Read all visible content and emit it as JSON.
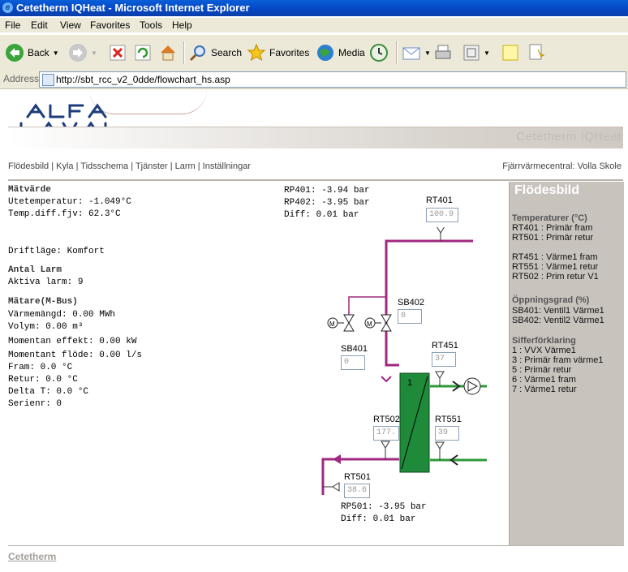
{
  "window": {
    "title": "Cetetherm IQHeat - Microsoft Internet Explorer"
  },
  "menu": [
    "File",
    "Edit",
    "View",
    "Favorites",
    "Tools",
    "Help"
  ],
  "toolbar": {
    "back": "Back",
    "search": "Search",
    "favorites": "Favorites",
    "media": "Media"
  },
  "address": {
    "label": "Address",
    "url": "http://sbt_rcc_v2_0dde/flowchart_hs.asp"
  },
  "brand": "Cetetherm IQHeat",
  "nav": "Flödesbild |  Kyla | Tidsschema | Tjänster | Larm | Inställningar",
  "facility": "Fjärrvärmecentral: Volla Skole",
  "left": {
    "matvarde_title": "Mätvärde",
    "ute": "Utetemperatur: -1.049°C",
    "tempdiff": "Temp.diff.fjv: 62.3°C",
    "drift": "Driftläge: Komfort",
    "antal_larm_title": "Antal Larm",
    "aktiva_larm": "Aktiva larm: 9",
    "matare_title": "Mätare(M-Bus)",
    "varmemangd": "Värmemängd: 0.00 MWh",
    "volym": "Volym: 0.00 m³",
    "effekt": "Momentan effekt: 0.00 kW",
    "flode": "Momentant flöde: 0.00 l/s",
    "fram": "Fram: 0.0 °C",
    "retur": "Retur: 0.0 °C",
    "deltat": "Delta T: 0.0 °C",
    "serienr": "Serienr: 0"
  },
  "diagram": {
    "rp401": "RP401: -3.94 bar",
    "rp402": "RP402: -3.95 bar",
    "diff1": "Diff: 0.01 bar",
    "rp501": "RP501: -3.95 bar",
    "diff2": "Diff: 0.01 bar",
    "rt401_label": "RT401",
    "rt401_value": "100.9",
    "sb402_label": "SB402",
    "sb402_value": "0",
    "sb401_label": "SB401",
    "sb401_value": "0",
    "rt451_label": "RT451",
    "rt451_value": "37",
    "rt502_label": "RT502",
    "rt502_value": "177.",
    "rt551_label": "RT551",
    "rt551_value": "39",
    "rt501_label": "RT501",
    "rt501_value": "38.6",
    "hx_number": "1",
    "motor_symbol": "M",
    "colors": {
      "primary": "#a0287f",
      "secondary": "#2e9a3a",
      "hx": "#1e8a3a"
    }
  },
  "panel": {
    "title": "Flödesbild",
    "temp_title": "Temperaturer (°C)",
    "temps": [
      "RT401 : Primär fram",
      "RT501 : Primär retur",
      "",
      "RT451 : Värme1 fram",
      "RT551 : Värme1 retur",
      "RT502 : Prim retur V1"
    ],
    "open_title": "Öppningsgrad (%)",
    "opens": [
      "SB401: Ventil1 Värme1",
      "SB402: Ventil2 Värme1"
    ],
    "digits_title": "Sifferförklaring",
    "digits": [
      "1 : VVX Värme1",
      "3 : Primär fram värme1",
      "5 : Primär retur",
      "6 : Värme1 fram",
      "7 : Värme1 retur"
    ]
  },
  "footer": {
    "logo": "Cetetherm"
  }
}
